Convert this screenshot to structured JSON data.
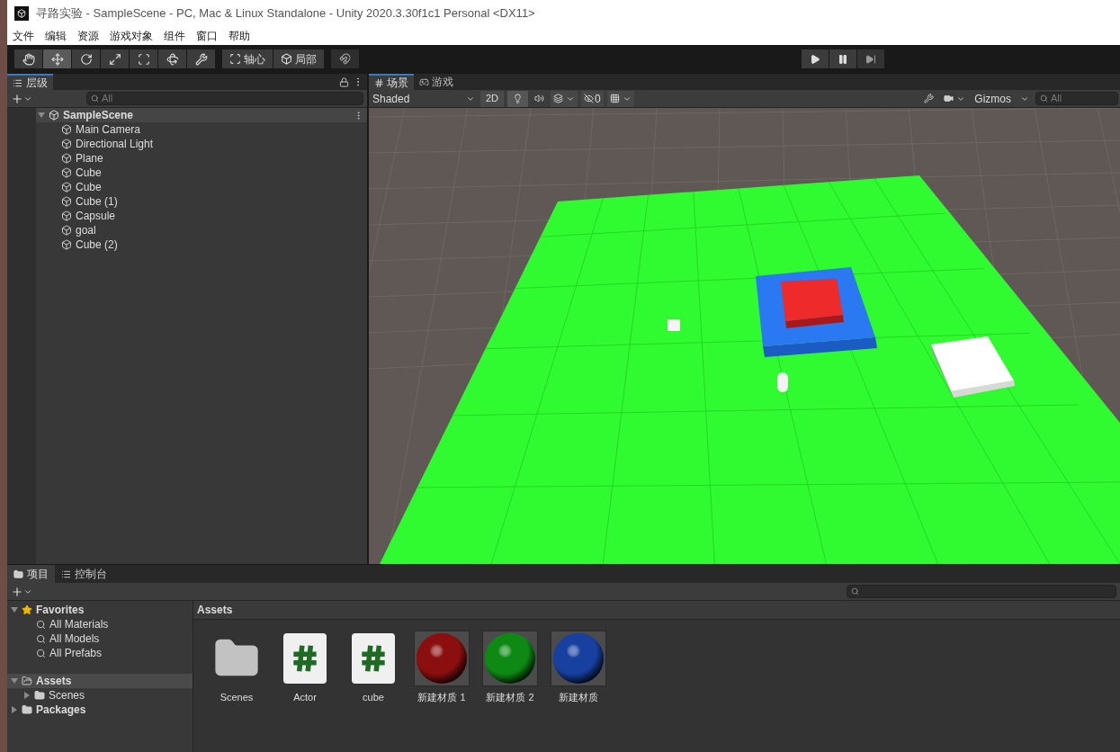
{
  "window": {
    "title": "寻路实验 - SampleScene - PC, Mac & Linux Standalone - Unity 2020.3.30f1c1 Personal <DX11>"
  },
  "menu": [
    "文件",
    "编辑",
    "资源",
    "游戏对象",
    "组件",
    "窗口",
    "帮助"
  ],
  "toolbar": {
    "tools": [
      {
        "kind": "hand",
        "selected": false
      },
      {
        "kind": "move",
        "selected": true
      },
      {
        "kind": "rotate",
        "selected": false
      },
      {
        "kind": "scale",
        "selected": false
      },
      {
        "kind": "rect",
        "selected": false
      },
      {
        "kind": "transform",
        "selected": false
      },
      {
        "kind": "custom",
        "selected": false
      }
    ],
    "pivot": [
      "轴心",
      "局部"
    ]
  },
  "hierarchy": {
    "tab": {
      "label": "层级",
      "selected": true
    },
    "search": {
      "placeholder": "All"
    },
    "scene": {
      "label": "SampleScene",
      "expanded": true,
      "children": [
        {
          "label": "Main Camera"
        },
        {
          "label": "Directional Light"
        },
        {
          "label": "Plane"
        },
        {
          "label": "Cube"
        },
        {
          "label": "Cube"
        },
        {
          "label": "Cube (1)"
        },
        {
          "label": "Capsule"
        },
        {
          "label": "goal"
        },
        {
          "label": "Cube (2)"
        }
      ]
    }
  },
  "scene_view": {
    "tabs": [
      {
        "label": "场景",
        "kind": "scene",
        "selected": true
      },
      {
        "label": "游戏",
        "kind": "game",
        "selected": false
      }
    ],
    "shading": "Shaded",
    "mode_2d": "2D",
    "hidden_count": "0",
    "gizmos": "Gizmos",
    "search": {
      "placeholder": "All"
    }
  },
  "project": {
    "tabs": [
      {
        "label": "项目",
        "kind": "project",
        "selected": true
      },
      {
        "label": "控制台",
        "kind": "console",
        "selected": false
      }
    ],
    "tree": [
      {
        "label": "Favorites",
        "kind": "favorites",
        "expanded": true,
        "selected": false,
        "children": [
          {
            "label": "All Materials"
          },
          {
            "label": "All Models"
          },
          {
            "label": "All Prefabs"
          }
        ]
      },
      {
        "label": "Assets",
        "kind": "folder",
        "expanded": true,
        "selected": true,
        "children": [
          {
            "label": "Scenes"
          }
        ]
      },
      {
        "label": "Packages",
        "kind": "folder",
        "expanded": false,
        "selected": false
      }
    ],
    "breadcrumb": "Assets",
    "assets": [
      {
        "label": "Scenes",
        "kind": "folder"
      },
      {
        "label": "Actor",
        "kind": "script"
      },
      {
        "label": "cube",
        "kind": "script"
      },
      {
        "label": "新建材质 1",
        "kind": "material",
        "color": "#8b0f0f"
      },
      {
        "label": "新建材质 2",
        "kind": "material",
        "color": "#0e8a14"
      },
      {
        "label": "新建材质",
        "kind": "material",
        "color": "#1740a0"
      }
    ]
  }
}
